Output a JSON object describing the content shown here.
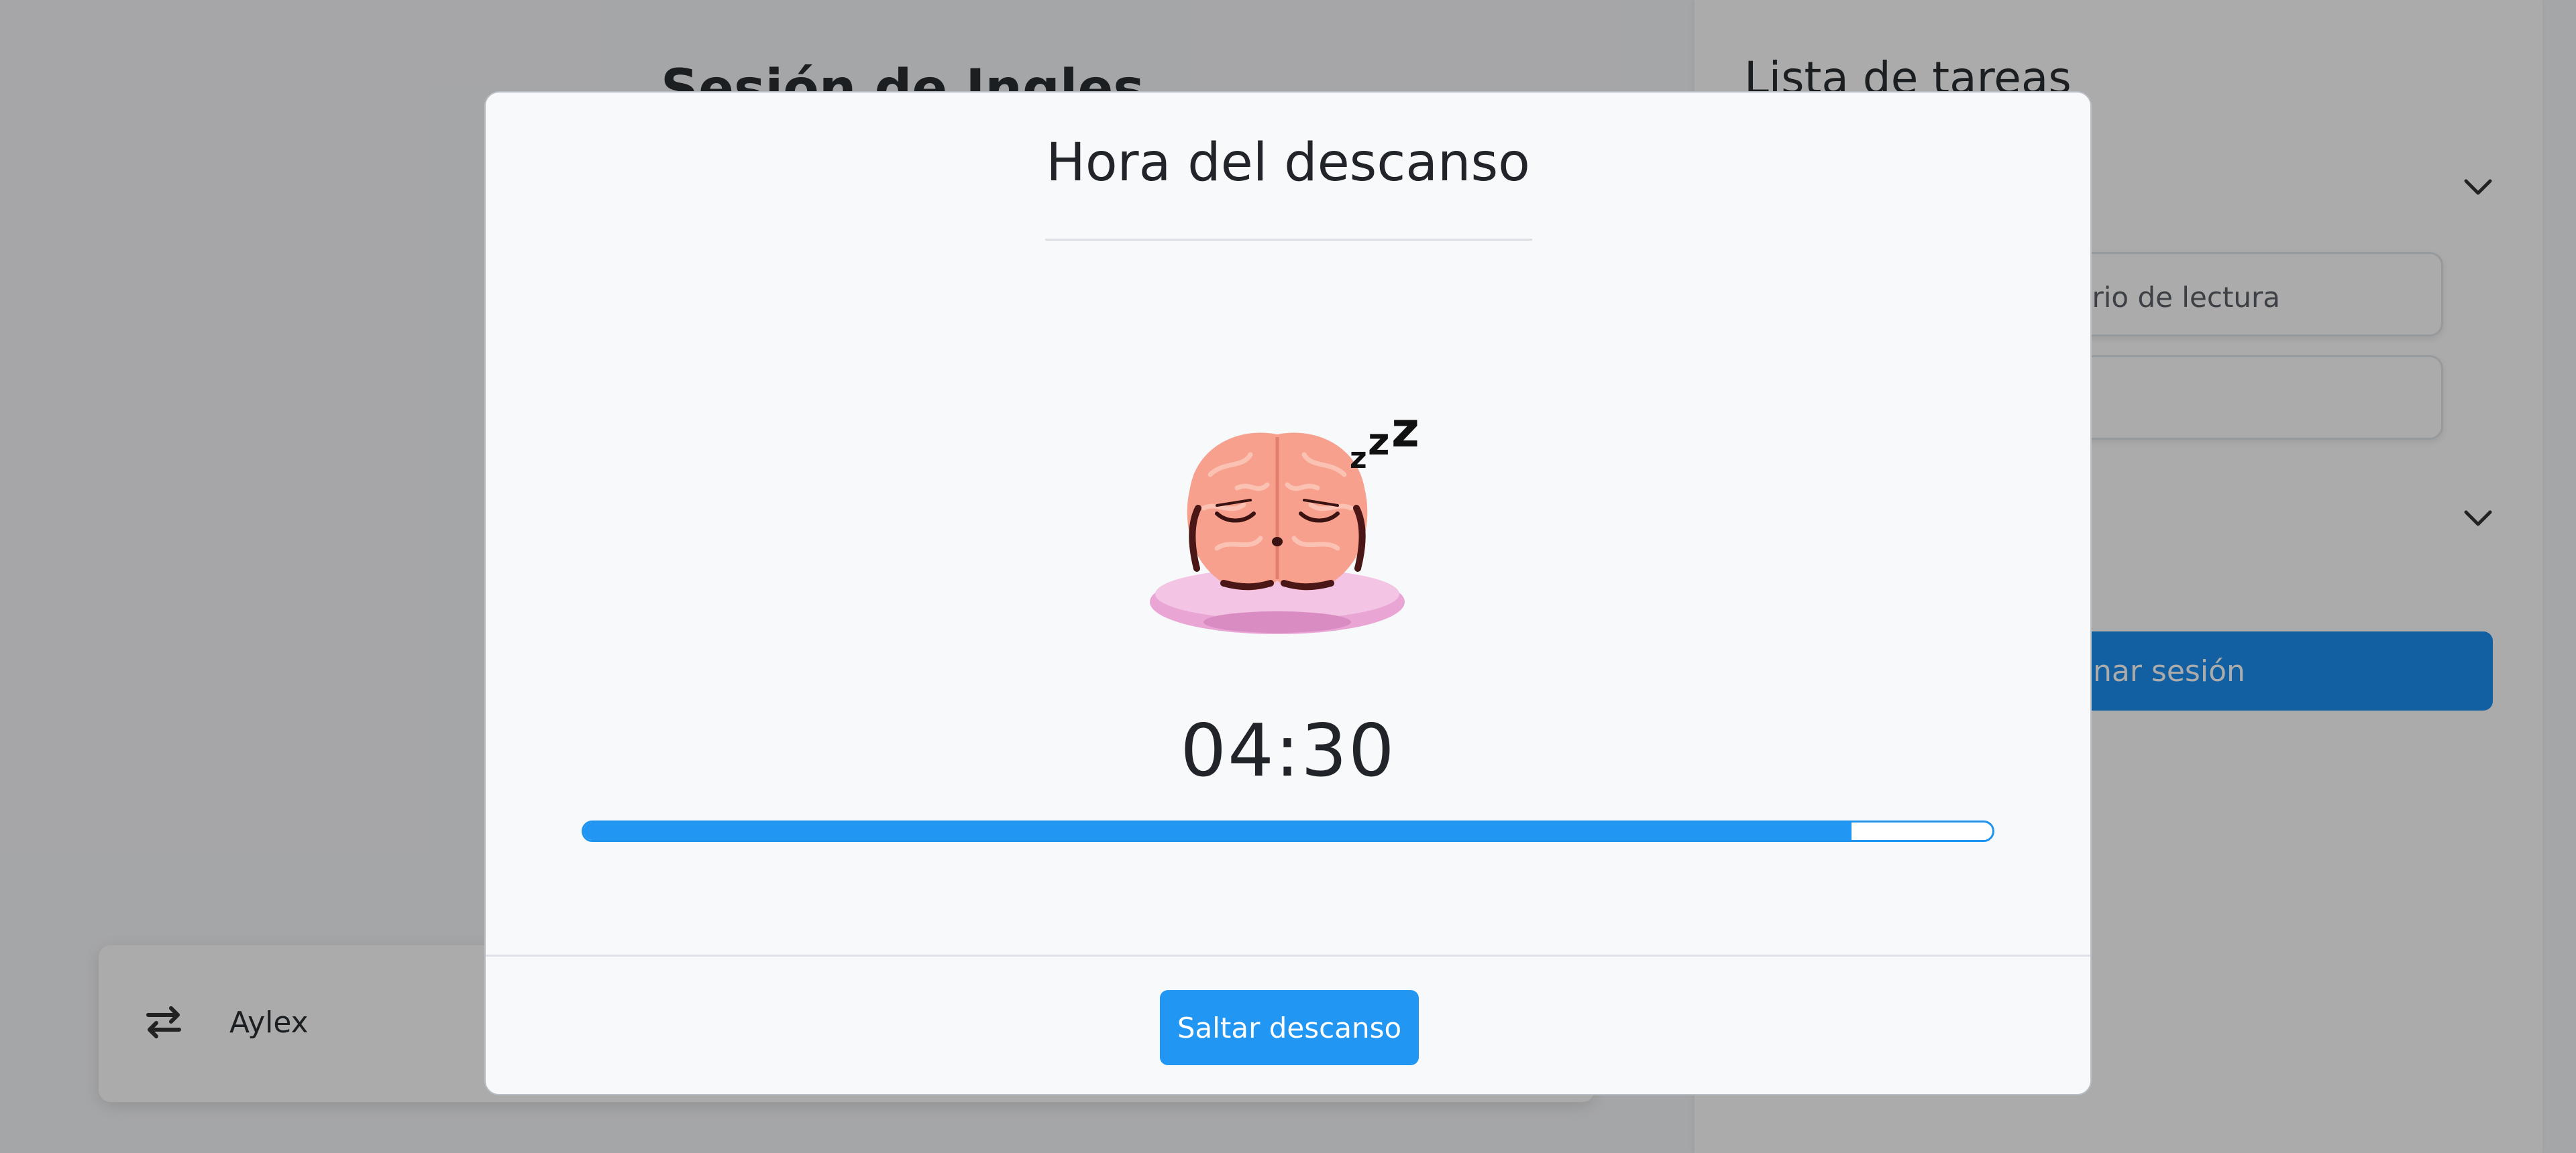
{
  "main": {
    "session_title": "Sesión de Ingles",
    "player": {
      "icon": "shuffle-icon",
      "name": "Aylex"
    }
  },
  "sidebar": {
    "title": "Lista de tareas",
    "tasks": [
      "ario de lectura",
      ""
    ],
    "end_session_label": "nar sesión",
    "icons": [
      "chevron-down-icon",
      "chevron-down-icon"
    ]
  },
  "modal": {
    "title": "Hora del descanso",
    "illustration": "sleeping-brain-icon",
    "timer": "04:30",
    "progress_percent": 90,
    "skip_label": "Saltar descanso"
  },
  "colors": {
    "accent": "#2196f3",
    "backdrop": "rgba(0,0,0,0.33)",
    "modal_bg": "#f7f9fb"
  }
}
